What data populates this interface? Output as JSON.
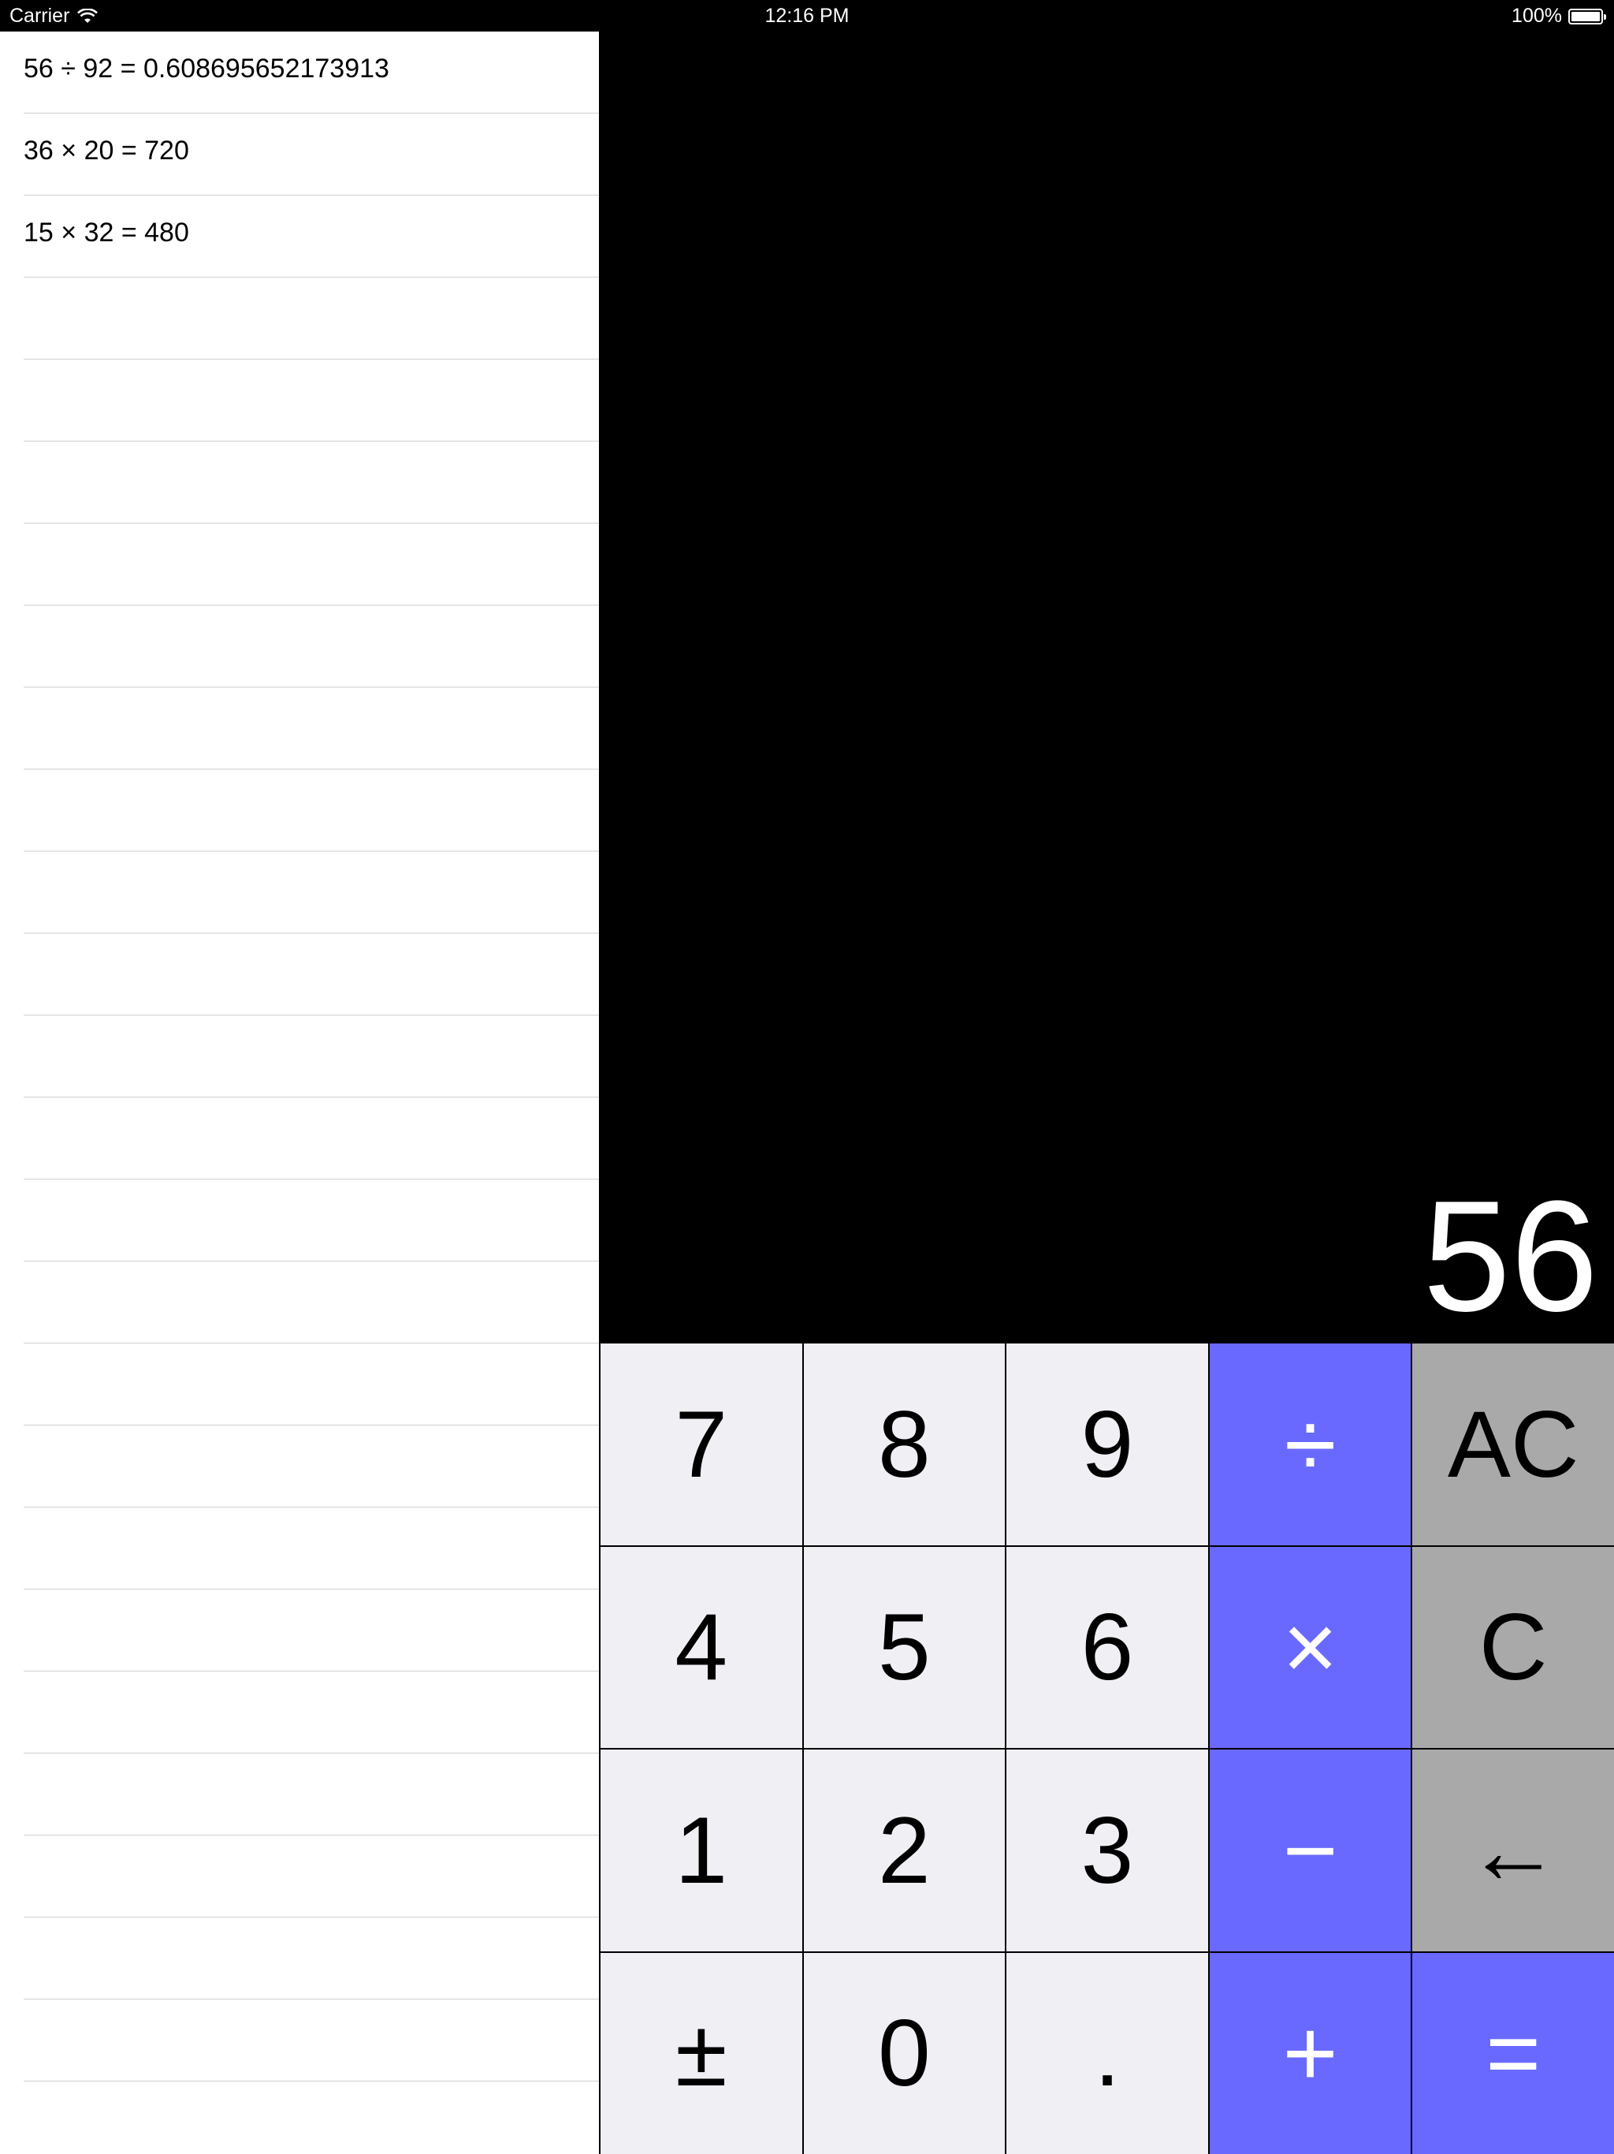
{
  "status_bar": {
    "carrier": "Carrier",
    "time": "12:16 PM",
    "battery_percent": "100%",
    "battery_level": 1.0,
    "wifi_icon": "wifi-icon",
    "battery_icon": "battery-icon"
  },
  "history": {
    "entries": [
      "56 ÷ 92 = 0.608695652173913",
      "36 × 20 = 720",
      "15 × 32 = 480",
      "",
      "",
      "",
      "",
      "",
      "",
      "",
      "",
      "",
      "",
      "",
      "",
      "",
      "",
      "",
      "",
      "",
      "",
      "",
      "",
      "",
      "",
      ""
    ]
  },
  "display": {
    "value": "56"
  },
  "keypad": {
    "keys": [
      {
        "label": "7",
        "kind": "digit",
        "name": "key-7"
      },
      {
        "label": "8",
        "kind": "digit",
        "name": "key-8"
      },
      {
        "label": "9",
        "kind": "digit",
        "name": "key-9"
      },
      {
        "label": "÷",
        "kind": "op",
        "name": "divide-button"
      },
      {
        "label": "AC",
        "kind": "fn",
        "name": "all-clear-button"
      },
      {
        "label": "4",
        "kind": "digit",
        "name": "key-4"
      },
      {
        "label": "5",
        "kind": "digit",
        "name": "key-5"
      },
      {
        "label": "6",
        "kind": "digit",
        "name": "key-6"
      },
      {
        "label": "×",
        "kind": "op",
        "name": "multiply-button"
      },
      {
        "label": "C",
        "kind": "fn",
        "name": "clear-button"
      },
      {
        "label": "1",
        "kind": "digit",
        "name": "key-1"
      },
      {
        "label": "2",
        "kind": "digit",
        "name": "key-2"
      },
      {
        "label": "3",
        "kind": "digit",
        "name": "key-3"
      },
      {
        "label": "−",
        "kind": "op",
        "name": "subtract-button"
      },
      {
        "label": "←",
        "kind": "fn",
        "name": "backspace-button"
      },
      {
        "label": "±",
        "kind": "digit",
        "name": "plus-minus-button"
      },
      {
        "label": "0",
        "kind": "digit",
        "name": "key-0"
      },
      {
        "label": ".",
        "kind": "digit",
        "name": "decimal-button"
      },
      {
        "label": "+",
        "kind": "op",
        "name": "add-button"
      },
      {
        "label": "=",
        "kind": "op",
        "name": "equals-button"
      }
    ]
  },
  "colors": {
    "operator_bg": "#6a69ff",
    "function_bg": "#a9a9a9",
    "digit_bg": "#efeff4",
    "display_bg": "#000000"
  }
}
